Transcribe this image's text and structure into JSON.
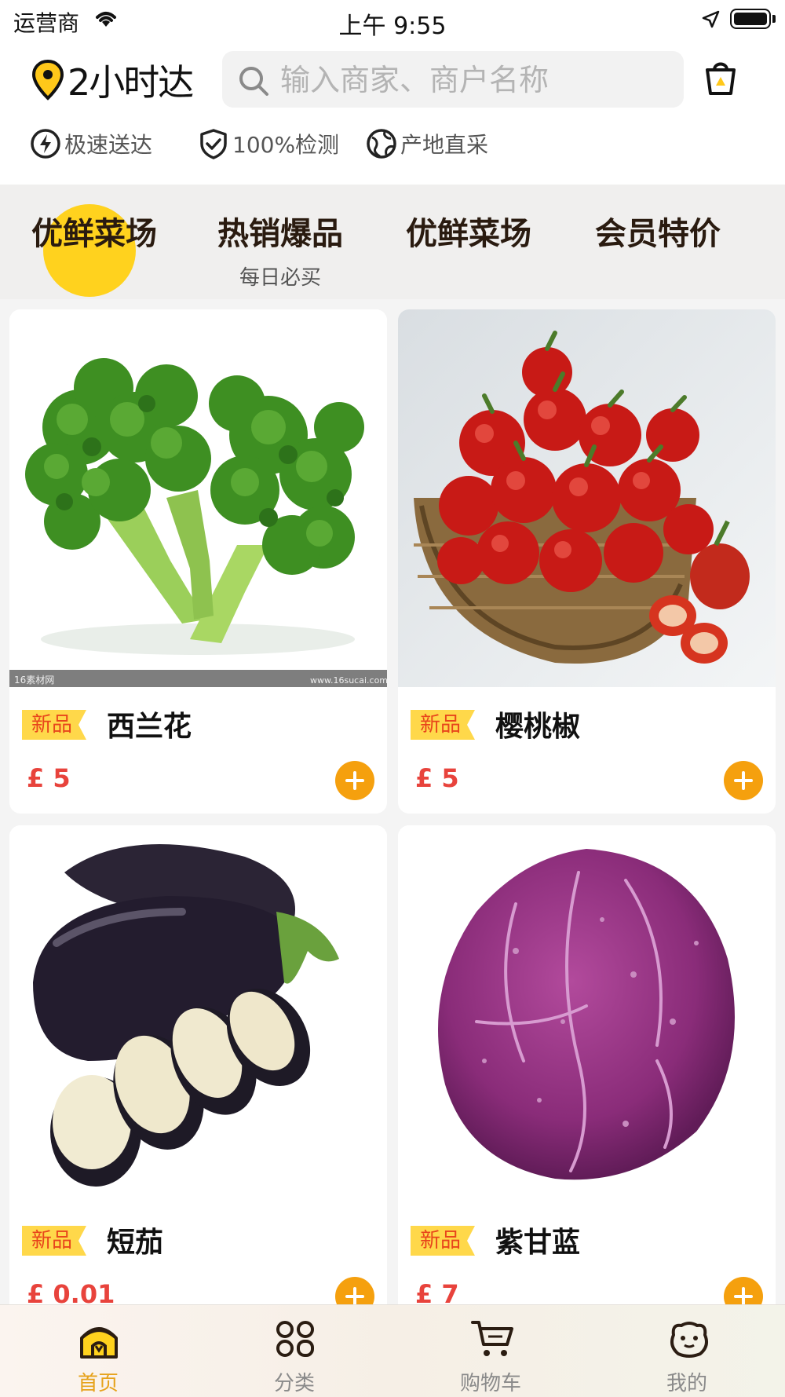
{
  "status_bar": {
    "carrier": "运营商",
    "time": "上午 9:55"
  },
  "header": {
    "logo_text": "2小时达",
    "search_placeholder": "输入商家、商户名称"
  },
  "features": [
    {
      "icon": "lightning-icon",
      "label": "极速送达"
    },
    {
      "icon": "shield-check-icon",
      "label": "100%检测"
    },
    {
      "icon": "globe-icon",
      "label": "产地直采"
    }
  ],
  "tabs": [
    {
      "title": "优鲜菜场",
      "subtitle": "",
      "active": true
    },
    {
      "title": "热销爆品",
      "subtitle": "每日必买"
    },
    {
      "title": "优鲜菜场",
      "subtitle": ""
    },
    {
      "title": "会员特价",
      "subtitle": ""
    }
  ],
  "products": [
    {
      "badge": "新品",
      "name": "西兰花",
      "price": "£ 5",
      "image": "broccoli"
    },
    {
      "badge": "新品",
      "name": "樱桃椒",
      "price": "£ 5",
      "image": "cherry-pepper"
    },
    {
      "badge": "新品",
      "name": "短茄",
      "price": "£ 0.01",
      "image": "eggplant"
    },
    {
      "badge": "新品",
      "name": "紫甘蓝",
      "price": "£ 7",
      "image": "red-cabbage"
    }
  ],
  "product_image_text": {
    "broccoli_watermark_left": "16素材网",
    "broccoli_watermark_right": "www.16sucai.com"
  },
  "tabbar": [
    {
      "label": "首页",
      "icon": "home-icon",
      "active": true
    },
    {
      "label": "分类",
      "icon": "category-icon"
    },
    {
      "label": "购物车",
      "icon": "cart-icon"
    },
    {
      "label": "我的",
      "icon": "profile-icon"
    }
  ],
  "colors": {
    "accent": "#f5a00e",
    "price": "#e8433c",
    "active_tab_dot": "#ffd21e",
    "badge_bg": "#ffd84a"
  }
}
